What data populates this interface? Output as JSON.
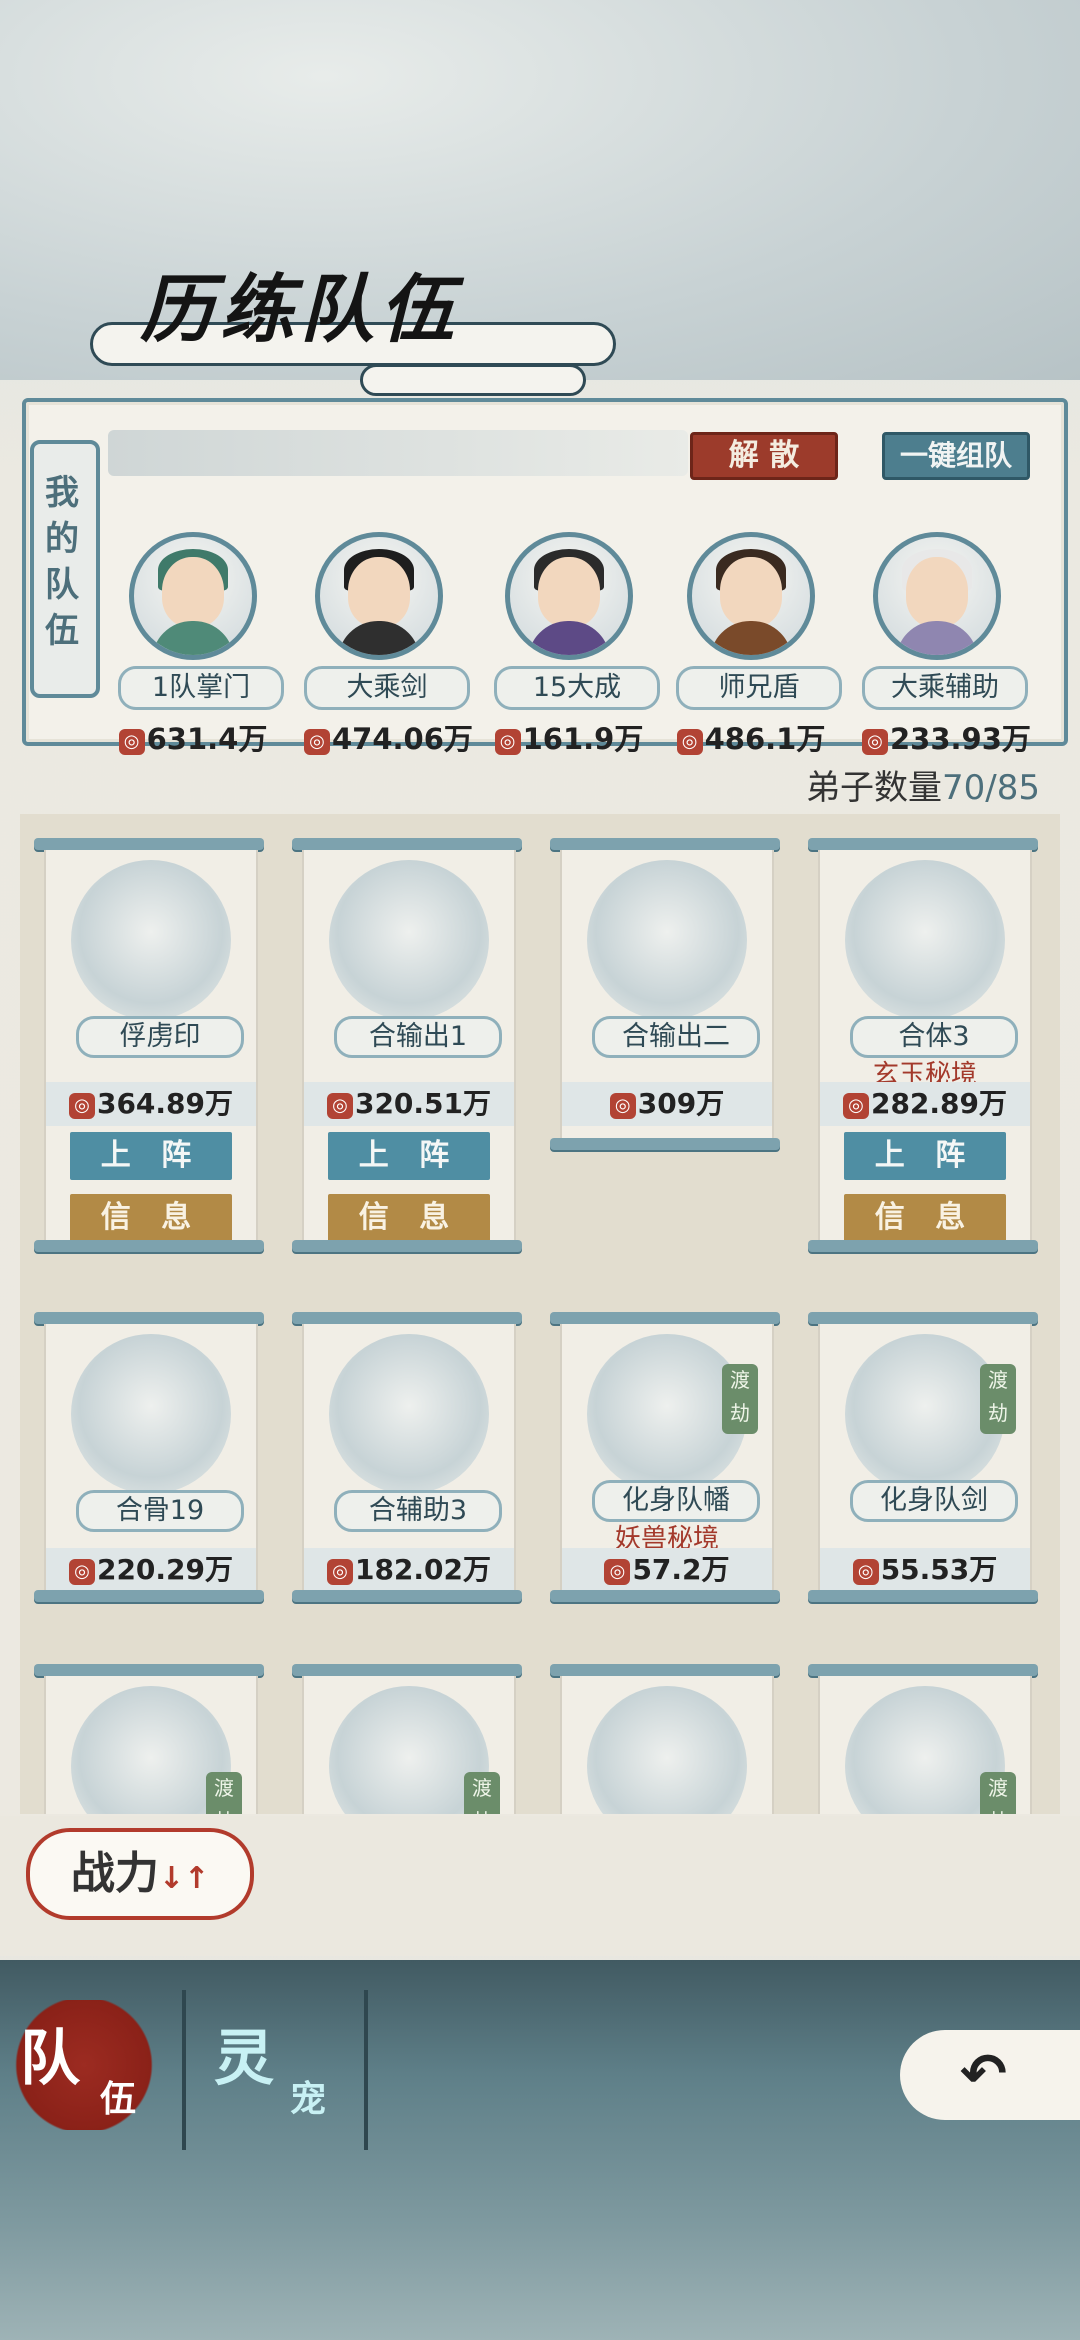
{
  "header": {
    "title": "历练队伍"
  },
  "team": {
    "side_label": "我的队伍",
    "disband_label": "解 散",
    "auto_form_label": "一键组队",
    "members": [
      {
        "name": "1队掌门",
        "power": "631.4万"
      },
      {
        "name": "大乘剑",
        "power": "474.06万"
      },
      {
        "name": "15大成",
        "power": "161.9万"
      },
      {
        "name": "师兄盾",
        "power": "486.1万"
      },
      {
        "name": "大乘辅助",
        "power": "233.93万"
      }
    ]
  },
  "disciples": {
    "count_label": "弟子数量",
    "count_value": "70/85",
    "deploy_label": "上 阵",
    "info_label": "信 息",
    "cards": [
      {
        "name": "俘虏印",
        "power": "364.89万",
        "sub": "",
        "badge": ""
      },
      {
        "name": "合输出1",
        "power": "320.51万",
        "sub": "",
        "badge": ""
      },
      {
        "name": "合输出二",
        "power": "309万",
        "sub": "",
        "badge": ""
      },
      {
        "name": "合体3",
        "power": "282.89万",
        "sub": "玄玉秘境",
        "badge": ""
      },
      {
        "name": "合骨19",
        "power": "220.29万",
        "sub": "",
        "badge": ""
      },
      {
        "name": "合辅助3",
        "power": "182.02万",
        "sub": "",
        "badge": ""
      },
      {
        "name": "化身队幡",
        "power": "57.2万",
        "sub": "妖兽秘境",
        "badge": "渡劫"
      },
      {
        "name": "化身队剑",
        "power": "55.53万",
        "sub": "",
        "badge": "渡劫"
      }
    ],
    "row3_badges": [
      "渡劫",
      "渡劫",
      "渡劫"
    ]
  },
  "sort": {
    "label": "战力",
    "arrows": "↓↑"
  },
  "tabs": {
    "team_big": "队",
    "team_small": "伍",
    "pet_big": "灵",
    "pet_small": "宠"
  },
  "back": {
    "glyph": "↶"
  },
  "icons": {
    "power": "gourd-icon"
  },
  "colors": {
    "accent_teal": "#4d7e8e",
    "accent_red": "#9c3b2b",
    "info_gold": "#b28a46"
  }
}
